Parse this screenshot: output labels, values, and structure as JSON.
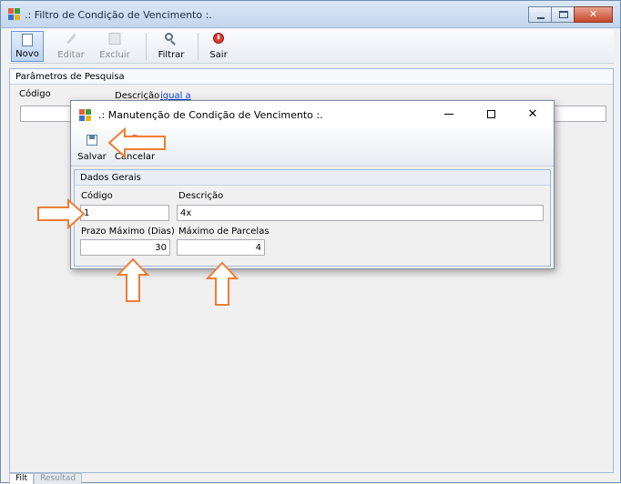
{
  "main_window": {
    "title": ".: Filtro de Condição de Vencimento :.",
    "toolbar": {
      "novo": "Novo",
      "editar": "Editar",
      "excluir": "Excluir",
      "filtrar": "Filtrar",
      "sair": "Sair"
    },
    "search": {
      "group_title": "Parâmetros de Pesquisa",
      "codigo_label": "Código",
      "descricao_label": "Descrição",
      "descricao_mode": "igual a",
      "codigo_value": "",
      "descricao_value": ""
    },
    "tabs": [
      "Filt",
      "Resultad"
    ]
  },
  "dialog": {
    "title": ".: Manutenção de Condição de Vencimento :.",
    "toolbar": {
      "salvar": "Salvar",
      "cancelar": "Cancelar"
    },
    "form": {
      "group_title": "Dados Gerais",
      "codigo_label": "Código",
      "codigo_value": "1",
      "descricao_label": "Descrição",
      "descricao_value": "4x",
      "prazo_label": "Prazo Máximo (Dias)",
      "prazo_value": "30",
      "parcelas_label": "Máximo de Parcelas",
      "parcelas_value": "4"
    }
  },
  "colors": {
    "callout_arrow": "#f07d32",
    "link": "#0b3fd6"
  }
}
